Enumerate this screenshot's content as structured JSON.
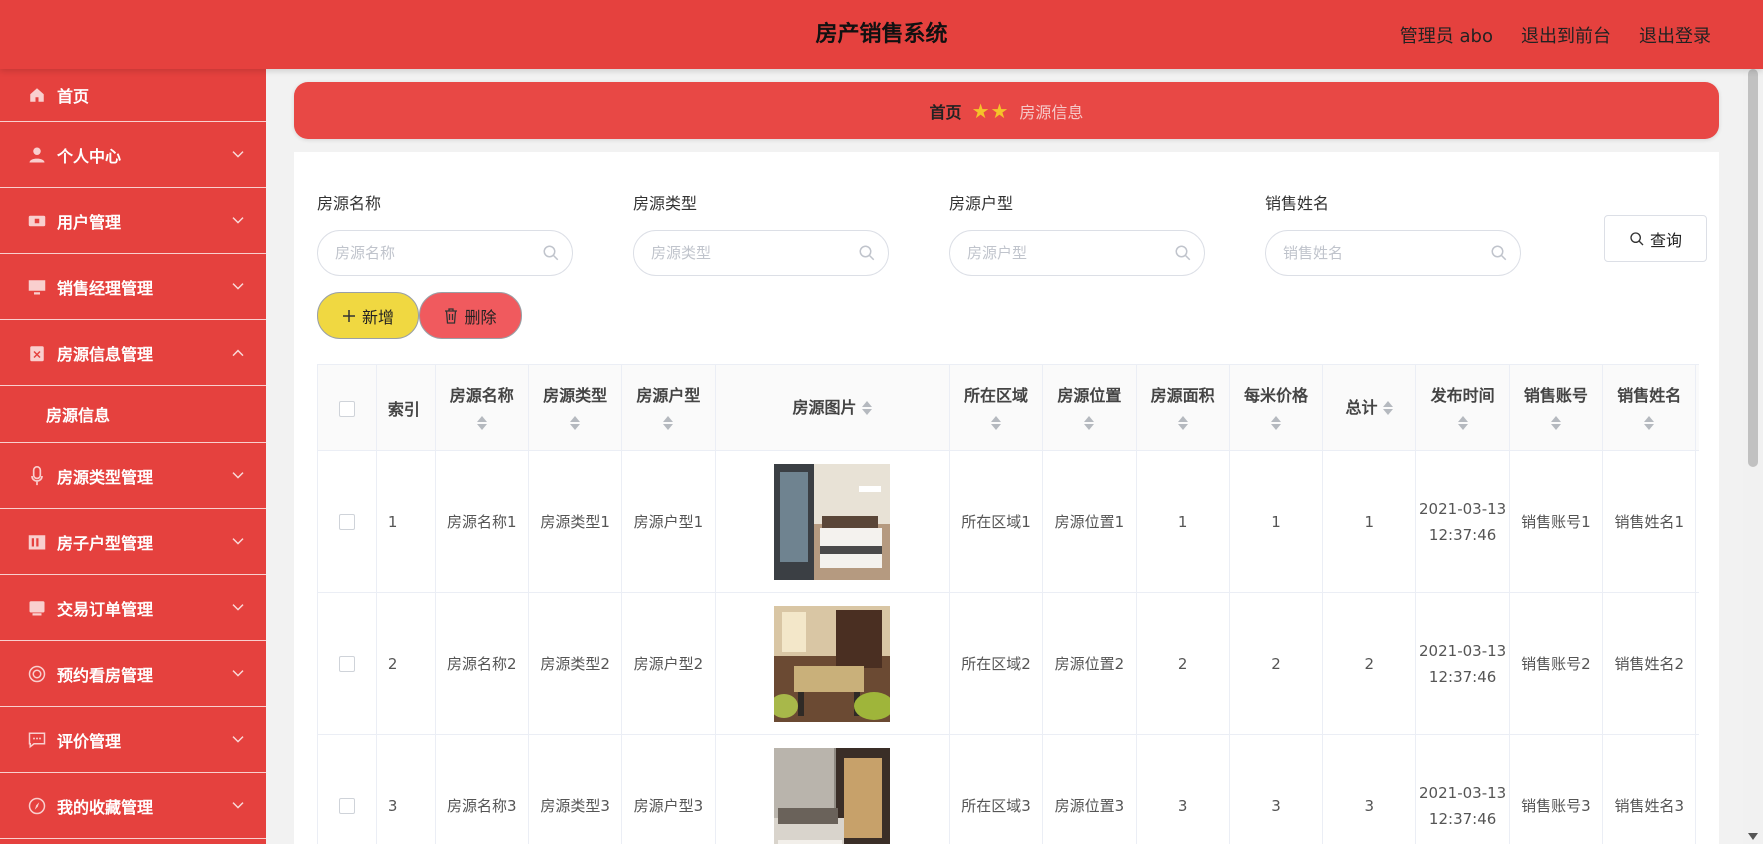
{
  "app": {
    "title": "房产销售系统"
  },
  "header": {
    "links": [
      "管理员 abo",
      "退出到前台",
      "退出登录"
    ]
  },
  "sidebar": {
    "items": [
      {
        "label": "首页",
        "icon": "home-icon"
      },
      {
        "label": "个人中心",
        "icon": "user-icon"
      },
      {
        "label": "用户管理",
        "icon": "users-icon"
      },
      {
        "label": "销售经理管理",
        "icon": "monitor-icon"
      },
      {
        "label": "房源信息管理",
        "icon": "clipboard-icon",
        "expanded": true,
        "children": [
          "房源信息"
        ]
      },
      {
        "label": "房源类型管理",
        "icon": "microphone-icon"
      },
      {
        "label": "房子户型管理",
        "icon": "building-icon"
      },
      {
        "label": "交易订单管理",
        "icon": "order-icon"
      },
      {
        "label": "预约看房管理",
        "icon": "target-icon"
      },
      {
        "label": "评价管理",
        "icon": "comment-icon"
      },
      {
        "label": "我的收藏管理",
        "icon": "compass-icon"
      }
    ]
  },
  "breadcrumb": {
    "home": "首页",
    "current": "房源信息"
  },
  "filters": [
    {
      "label": "房源名称",
      "placeholder": "房源名称"
    },
    {
      "label": "房源类型",
      "placeholder": "房源类型"
    },
    {
      "label": "房源户型",
      "placeholder": "房源户型"
    },
    {
      "label": "销售姓名",
      "placeholder": "销售姓名"
    }
  ],
  "buttons": {
    "query": "查询",
    "add": "新增",
    "delete": "删除"
  },
  "table": {
    "columns": [
      "索引",
      "房源名称",
      "房源类型",
      "房源户型",
      "房源图片",
      "所在区域",
      "房源位置",
      "房源面积",
      "每米价格",
      "总计",
      "发布时间",
      "销售账号",
      "销售姓名"
    ],
    "rows": [
      {
        "index": "1",
        "name": "房源名称1",
        "type": "房源类型1",
        "layout": "房源户型1",
        "area": "所在区域1",
        "location": "房源位置1",
        "size": "1",
        "price": "1",
        "total": "1",
        "time": "2021-03-13 12:37:46",
        "account": "销售账号1",
        "seller": "销售姓名1",
        "image": "bedroom-photo"
      },
      {
        "index": "2",
        "name": "房源名称2",
        "type": "房源类型2",
        "layout": "房源户型2",
        "area": "所在区域2",
        "location": "房源位置2",
        "size": "2",
        "price": "2",
        "total": "2",
        "time": "2021-03-13 12:37:46",
        "account": "销售账号2",
        "seller": "销售姓名2",
        "image": "dining-room-photo"
      },
      {
        "index": "3",
        "name": "房源名称3",
        "type": "房源类型3",
        "layout": "房源户型3",
        "area": "所在区域3",
        "location": "房源位置3",
        "size": "3",
        "price": "3",
        "total": "3",
        "time": "2021-03-13 12:37:46",
        "account": "销售账号3",
        "seller": "销售姓名3",
        "image": "wardrobe-bedroom-photo"
      }
    ]
  },
  "colors": {
    "primary": "#e5413e",
    "add": "#f0d841",
    "delete": "#f05a5e",
    "star": "#f5c22a"
  }
}
